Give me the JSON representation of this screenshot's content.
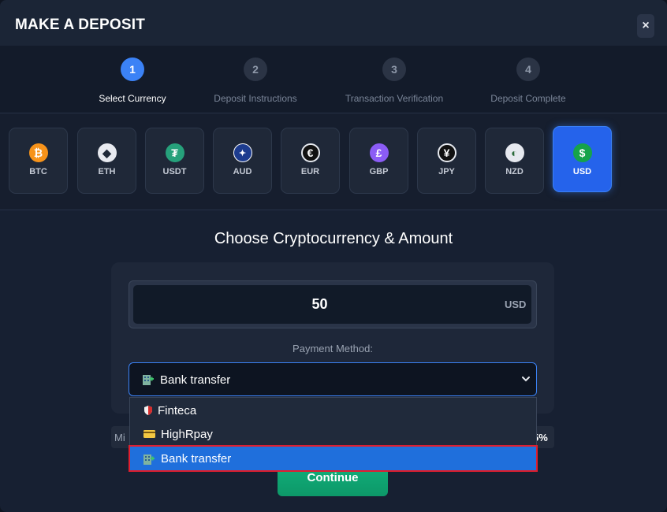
{
  "modal": {
    "title": "MAKE A DEPOSIT",
    "close_glyph": "×"
  },
  "stepper": {
    "steps": [
      {
        "number": "1",
        "label": "Select Currency",
        "active": true
      },
      {
        "number": "2",
        "label": "Deposit Instructions",
        "active": false
      },
      {
        "number": "3",
        "label": "Transaction Verification",
        "active": false
      },
      {
        "number": "4",
        "label": "Deposit Complete",
        "active": false
      }
    ]
  },
  "currencies": [
    {
      "code": "BTC",
      "icon": "bitcoin-icon",
      "glyph": "₿",
      "color": "#f7931a"
    },
    {
      "code": "ETH",
      "icon": "ethereum-icon",
      "glyph": "◆",
      "color": "#e8eaf0"
    },
    {
      "code": "USDT",
      "icon": "tether-icon",
      "glyph": "₮",
      "color": "#26a17b"
    },
    {
      "code": "AUD",
      "icon": "australia-flag-icon",
      "glyph": "✦",
      "color": "#1d3c8f"
    },
    {
      "code": "EUR",
      "icon": "euro-icon",
      "glyph": "€",
      "color": "#111111"
    },
    {
      "code": "GBP",
      "icon": "pound-icon",
      "glyph": "£",
      "color": "#8b5cf6"
    },
    {
      "code": "JPY",
      "icon": "yen-icon",
      "glyph": "¥",
      "color": "#111111"
    },
    {
      "code": "NZD",
      "icon": "new-zealand-icon",
      "glyph": "◐",
      "color": "#e6e9ef"
    },
    {
      "code": "USD",
      "icon": "dollar-icon",
      "glyph": "$",
      "color": "#16a34a",
      "selected": true
    }
  ],
  "main": {
    "section_title": "Choose Cryptocurrency & Amount",
    "amount_value": "50",
    "amount_currency": "USD",
    "payment_method_label": "Payment Method:",
    "selected_method": "Bank transfer",
    "behind_left_text": "Mi",
    "behind_right_text": "5%",
    "continue_label": "Continue"
  },
  "dropdown": {
    "options": [
      {
        "label": "Finteca",
        "icon": "shield-icon",
        "selected": false
      },
      {
        "label": "HighRpay",
        "icon": "card-icon",
        "selected": false
      },
      {
        "label": "Bank transfer",
        "icon": "bank-icon",
        "selected": true
      }
    ]
  },
  "colors": {
    "accent": "#3b82f6",
    "continue": "#12b47f",
    "highlight_outline": "#e01e2e"
  }
}
